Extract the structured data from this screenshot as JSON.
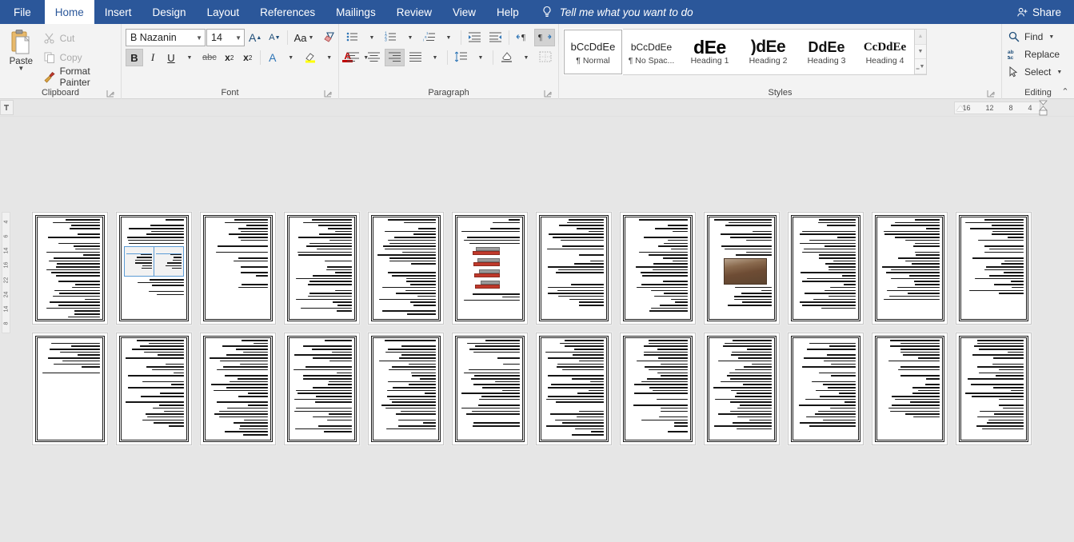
{
  "app": {
    "ribbon_tabs": [
      {
        "id": "file",
        "label": "File"
      },
      {
        "id": "home",
        "label": "Home",
        "active": true
      },
      {
        "id": "insert",
        "label": "Insert"
      },
      {
        "id": "design",
        "label": "Design"
      },
      {
        "id": "layout",
        "label": "Layout"
      },
      {
        "id": "references",
        "label": "References"
      },
      {
        "id": "mailings",
        "label": "Mailings"
      },
      {
        "id": "review",
        "label": "Review"
      },
      {
        "id": "view",
        "label": "View"
      },
      {
        "id": "help",
        "label": "Help"
      }
    ],
    "tell_me": "Tell me what you want to do",
    "share_label": "Share",
    "titlebar_color": "#2B579A",
    "ribbon_color": "#F3F3F3",
    "workspace_color": "#E6E6E6"
  },
  "clipboard": {
    "group_label": "Clipboard",
    "paste_label": "Paste",
    "cut_label": "Cut",
    "copy_label": "Copy",
    "format_painter_label": "Format Painter",
    "cut_icon": "scissors-icon",
    "copy_icon": "copy-icon",
    "format_painter_icon": "paintbrush-icon",
    "paste_icon": "clipboard-icon"
  },
  "font": {
    "group_label": "Font",
    "font_name": "B Nazanin",
    "font_size": "14",
    "grow_font": "A",
    "shrink_font": "A",
    "change_case": "Aa",
    "clear_formatting_icon": "clear-formatting-icon",
    "bold": "B",
    "bold_active": true,
    "italic": "I",
    "underline": "U",
    "strikethrough": "abc",
    "subscript": "x",
    "subscript_index": "2",
    "superscript": "x",
    "superscript_index": "2",
    "text_effects": "A",
    "highlight_icon": "highlight-icon",
    "font_color": "A",
    "font_color_swatch": "#C00000",
    "highlight_swatch": "#FFFF00"
  },
  "paragraph": {
    "group_label": "Paragraph",
    "bullets_icon": "bullet-list-icon",
    "numbering_icon": "numbered-list-icon",
    "multilevel_icon": "multilevel-list-icon",
    "decrease_indent_icon": "decrease-indent-icon",
    "increase_indent_icon": "increase-indent-icon",
    "ltr_icon": "left-to-right-icon",
    "rtl_icon": "right-to-left-icon",
    "rtl_active": true,
    "sort_icon": "sort-icon",
    "show_marks_icon": "pilcrow-icon",
    "align_left_icon": "align-left-icon",
    "align_center_icon": "align-center-icon",
    "align_right_icon": "align-right-icon",
    "align_right_active": true,
    "justify_icon": "justify-icon",
    "line_spacing_icon": "line-spacing-icon",
    "shading_icon": "shading-icon",
    "borders_icon": "borders-icon"
  },
  "styles": {
    "group_label": "Styles",
    "items": [
      {
        "sample": "bCcDdEe",
        "name": "¶ Normal",
        "variant": "normal",
        "selected": true
      },
      {
        "sample": "bCcDdEe",
        "name": "¶ No Spac...",
        "variant": "nospace",
        "selected": false
      },
      {
        "sample": "dEe",
        "name": "Heading 1",
        "variant": "h1",
        "selected": false
      },
      {
        "sample": ")dEe",
        "name": "Heading 2",
        "variant": "h2",
        "selected": false
      },
      {
        "sample": "DdEe",
        "name": "Heading 3",
        "variant": "h3",
        "selected": false
      },
      {
        "sample": "CcDdEe",
        "name": "Heading 4",
        "variant": "h4",
        "selected": false
      }
    ],
    "scroll_up_icon": "scroll-up-icon",
    "scroll_down_icon": "scroll-down-icon",
    "more_styles_icon": "more-styles-icon"
  },
  "editing": {
    "group_label": "Editing",
    "find_label": "Find",
    "find_icon": "search-icon",
    "replace_label": "Replace",
    "replace_icon": "replace-icon",
    "select_label": "Select",
    "select_icon": "cursor-select-icon"
  },
  "ruler": {
    "tab_stop_icon": "tab-stop-icon",
    "horizontal_ticks": [
      "16",
      "12",
      "8",
      "4"
    ],
    "vertical_ticks": [
      "4",
      "6",
      "14",
      "16",
      "22",
      "24",
      "14",
      "8"
    ],
    "first_line_indent_icon": "first-line-indent-marker",
    "right_indent_icon": "right-indent-marker"
  },
  "document": {
    "view": "multiple-pages",
    "page_count": 24,
    "rows": 2,
    "pages_per_row": 12,
    "text_direction": "rtl",
    "pages": [
      {
        "n": 1,
        "content": "text",
        "lines": 34
      },
      {
        "n": 2,
        "content": "table",
        "lines": 26
      },
      {
        "n": 3,
        "content": "text-sparse",
        "lines": 24
      },
      {
        "n": 4,
        "content": "text",
        "lines": 32
      },
      {
        "n": 5,
        "content": "text",
        "lines": 33
      },
      {
        "n": 6,
        "content": "machinery-figure",
        "lines": 20
      },
      {
        "n": 7,
        "content": "text",
        "lines": 30
      },
      {
        "n": 8,
        "content": "text",
        "lines": 32
      },
      {
        "n": 9,
        "content": "photo",
        "lines": 24
      },
      {
        "n": 10,
        "content": "text",
        "lines": 31
      },
      {
        "n": 11,
        "content": "text",
        "lines": 28
      },
      {
        "n": 12,
        "content": "text",
        "lines": 27
      },
      {
        "n": 13,
        "content": "text-short",
        "lines": 12
      },
      {
        "n": 14,
        "content": "text",
        "lines": 30
      },
      {
        "n": 15,
        "content": "text",
        "lines": 33
      },
      {
        "n": 16,
        "content": "text",
        "lines": 32
      },
      {
        "n": 17,
        "content": "text",
        "lines": 31
      },
      {
        "n": 18,
        "content": "text",
        "lines": 30
      },
      {
        "n": 19,
        "content": "text",
        "lines": 33
      },
      {
        "n": 20,
        "content": "text",
        "lines": 32
      },
      {
        "n": 21,
        "content": "text",
        "lines": 31
      },
      {
        "n": 22,
        "content": "text",
        "lines": 30
      },
      {
        "n": 23,
        "content": "text",
        "lines": 28
      },
      {
        "n": 24,
        "content": "text",
        "lines": 31
      }
    ]
  }
}
